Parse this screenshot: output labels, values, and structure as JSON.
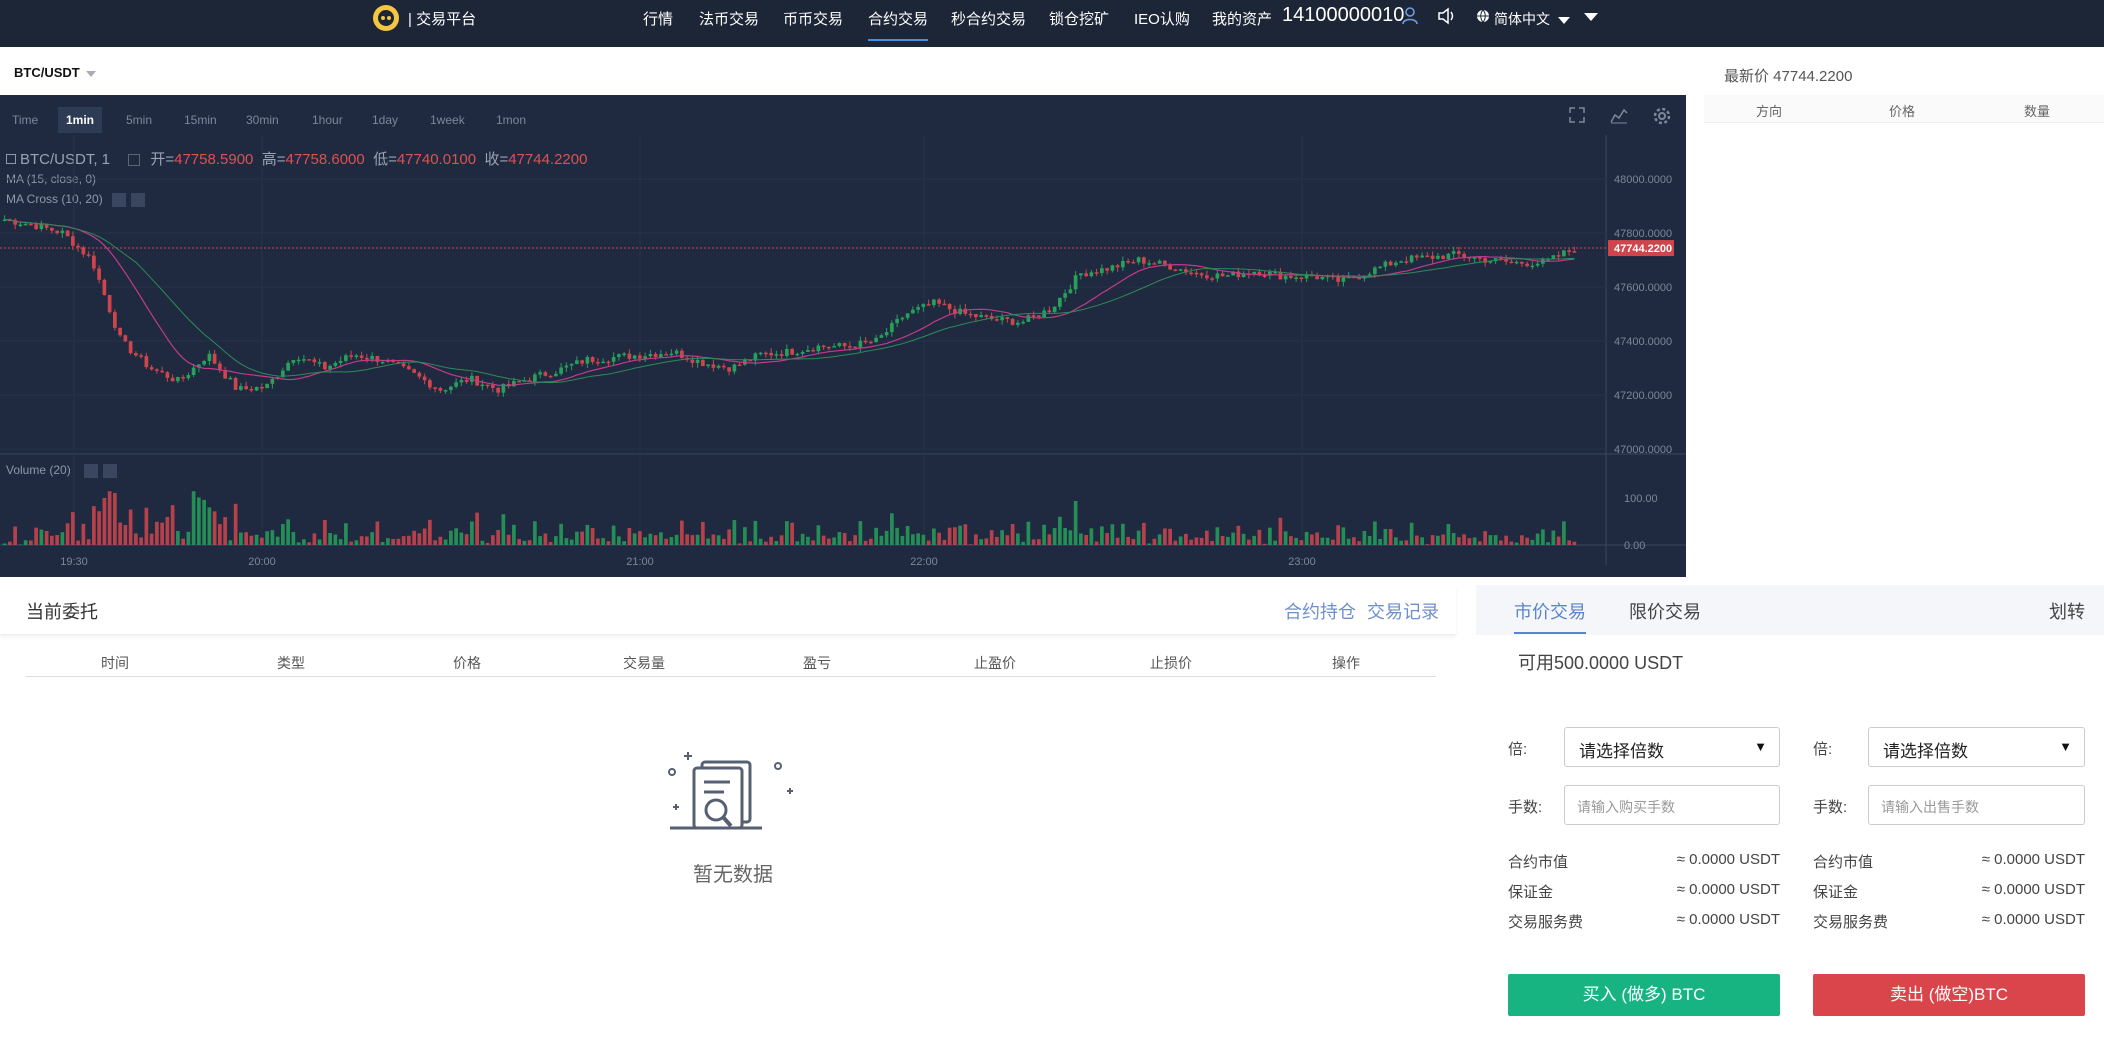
{
  "nav": {
    "brand": "| 交易平台",
    "items": [
      {
        "label": "行情"
      },
      {
        "label": "法币交易"
      },
      {
        "label": "币币交易"
      },
      {
        "label": "合约交易",
        "active": true
      },
      {
        "label": "秒合约交易"
      },
      {
        "label": "锁仓挖矿"
      },
      {
        "label": "IEO认购"
      },
      {
        "label": "我的资产"
      }
    ],
    "account": "14100000010",
    "language": "简体中文"
  },
  "pair": "BTC/USDT",
  "chart_toolbar": {
    "timeframes": [
      "Time",
      "1min",
      "5min",
      "15min",
      "30min",
      "1hour",
      "1day",
      "1week",
      "1mon"
    ],
    "active": "1min"
  },
  "chart_legend": {
    "symbol": "BTC/USDT, 1",
    "open_label": "开=",
    "open": "47758.5900",
    "high_label": "高=",
    "high": "47758.6000",
    "low_label": "低=",
    "low": "47740.0100",
    "close_label": "收=",
    "close": "47744.2200",
    "ma": "MA (15, close, 0)",
    "macross": "MA Cross (10, 20)",
    "volume": "Volume (20)"
  },
  "chart_data": {
    "type": "candlestick",
    "price_axis": [
      "48000.0000",
      "47800.0000",
      "47600.0000",
      "47400.0000",
      "47200.0000",
      "47000.0000"
    ],
    "last_price_tag": "47744.2200",
    "volume_axis": [
      "100.00",
      "0.00"
    ],
    "time_axis": [
      "19:30",
      "20:00",
      "21:00",
      "22:00",
      "23:00"
    ],
    "ylim": [
      47000,
      48000
    ],
    "volume_ylim": [
      0,
      160
    ],
    "close_path": [
      47850,
      47830,
      47800,
      47700,
      47400,
      47300,
      47250,
      47350,
      47220,
      47230,
      47350,
      47300,
      47350,
      47330,
      47280,
      47220,
      47260,
      47220,
      47260,
      47290,
      47330,
      47340,
      47350,
      47360,
      47320,
      47300,
      47350,
      47360,
      47380,
      47380,
      47400,
      47500,
      47540,
      47500,
      47480,
      47470,
      47520,
      47650,
      47670,
      47700,
      47680,
      47650,
      47640,
      47660,
      47640,
      47640,
      47620,
      47660,
      47700,
      47710,
      47720,
      47700,
      47690,
      47690,
      47744
    ]
  },
  "orderbook": {
    "last_price": "最新价 47744.2200",
    "columns": [
      "方向",
      "价格",
      "数量"
    ]
  },
  "orders": {
    "title": "当前委托",
    "links": [
      "合约持仓",
      "交易记录"
    ],
    "columns": [
      "时间",
      "类型",
      "价格",
      "交易量",
      "盈亏",
      "止盈价",
      "止损价",
      "操作"
    ],
    "empty": "暂无数据"
  },
  "trade": {
    "tabs": [
      "市价交易",
      "限价交易"
    ],
    "transfer": "划转",
    "available": "可用500.0000 USDT",
    "buy": {
      "leverage_label": "倍:",
      "leverage_select": "请选择倍数",
      "qty_label": "手数:",
      "qty_placeholder": "请输入购买手数",
      "rows": [
        {
          "label": "合约市值",
          "value": "≈ 0.0000 USDT"
        },
        {
          "label": "保证金",
          "value": "≈ 0.0000 USDT"
        },
        {
          "label": "交易服务费",
          "value": "≈ 0.0000 USDT"
        }
      ],
      "button": "买入 (做多) BTC"
    },
    "sell": {
      "leverage_label": "倍:",
      "leverage_select": "请选择倍数",
      "qty_label": "手数:",
      "qty_placeholder": "请输入出售手数",
      "rows": [
        {
          "label": "合约市值",
          "value": "≈ 0.0000 USDT"
        },
        {
          "label": "保证金",
          "value": "≈ 0.0000 USDT"
        },
        {
          "label": "交易服务费",
          "value": "≈ 0.0000 USDT"
        }
      ],
      "button": "卖出 (做空)BTC"
    }
  },
  "colors": {
    "nav_bg": "#1d2636",
    "chart_bg": "#1f2a40",
    "up": "#26a05a",
    "down": "#d0454c",
    "buy": "#17b482",
    "sell": "#d9454a",
    "accent": "#5b84c9"
  }
}
